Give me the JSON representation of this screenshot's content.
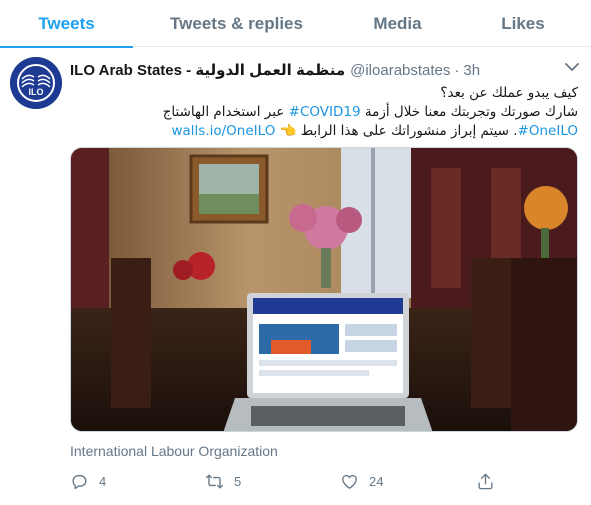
{
  "tabs": [
    {
      "label": "Tweets",
      "active": true
    },
    {
      "label": "Tweets & replies",
      "active": false
    },
    {
      "label": "Media",
      "active": false
    },
    {
      "label": "Likes",
      "active": false
    }
  ],
  "tweet": {
    "author_name": "ILO Arab States - منظمة العمل الدولية",
    "handle": "@iloarabstates",
    "separator": "·",
    "time": "3h",
    "text_lines": [
      {
        "plain": "كيف يبدو عملك عن بعد؟"
      },
      {
        "before": "شارك صورتك وتجربتك معنا خلال أزمة ",
        "hashtag": "#COVID19",
        "after": " عبر استخدام الهاشتاج"
      },
      {
        "hashtag": "#OneILO",
        "middle": ". سيتم إبراز منشوراتك على هذا الرابط ",
        "emoji": "👈",
        "url": "walls.io/OneILO"
      }
    ],
    "media_alt": "Laptop showing the ILO website on a dining table in a living room",
    "card_source": "International Labour Organization",
    "counts": {
      "replies": "4",
      "retweets": "5",
      "likes": "24"
    }
  },
  "icons": {
    "avatar": "ilo-logo-icon",
    "menu": "chevron-down-icon",
    "reply": "reply-icon",
    "retweet": "retweet-icon",
    "like": "heart-icon",
    "share": "share-icon"
  },
  "colors": {
    "accent": "#1da1f2",
    "link": "#1b95e0",
    "muted": "#657786",
    "avatar_bg": "#1f3a93"
  }
}
